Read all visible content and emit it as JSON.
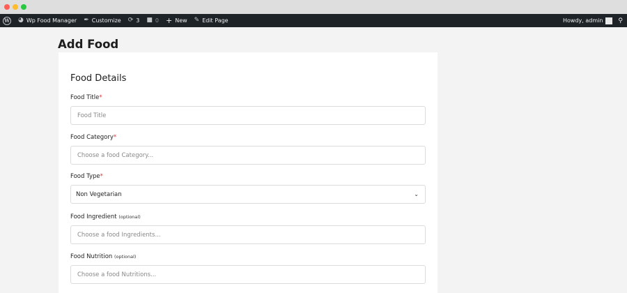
{
  "adminbar": {
    "site_name": "Wp Food Manager",
    "customize": "Customize",
    "updates_count": "3",
    "comments_count": "0",
    "new": "New",
    "edit_page": "Edit Page",
    "howdy": "Howdy, admin"
  },
  "page": {
    "title": "Add Food",
    "section_title": "Food Details"
  },
  "form": {
    "food_title": {
      "label": "Food Title",
      "required": "*",
      "placeholder": "Food Title"
    },
    "food_category": {
      "label": "Food Category",
      "required": "*",
      "placeholder": "Choose a food Category..."
    },
    "food_type": {
      "label": "Food Type",
      "required": "*",
      "value": "Non Vegetarian"
    },
    "food_ingredient": {
      "label": "Food Ingredient",
      "optional": "(optional)",
      "placeholder": "Choose a food Ingredients..."
    },
    "food_nutrition": {
      "label": "Food Nutrition",
      "optional": "(optional)",
      "placeholder": "Choose a food Nutritions..."
    }
  },
  "icons": {
    "wp_logo": "wordpress-icon",
    "site": "dashboard-icon",
    "customize": "brush-icon",
    "updates": "refresh-icon",
    "comments": "comment-icon",
    "new": "plus-icon",
    "edit": "pencil-icon",
    "search": "search-icon",
    "select": "chevron-down-icon"
  },
  "colors": {
    "adminbar_bg": "#1d2327",
    "required": "#d63638",
    "page_bg": "#f3f3f3"
  }
}
